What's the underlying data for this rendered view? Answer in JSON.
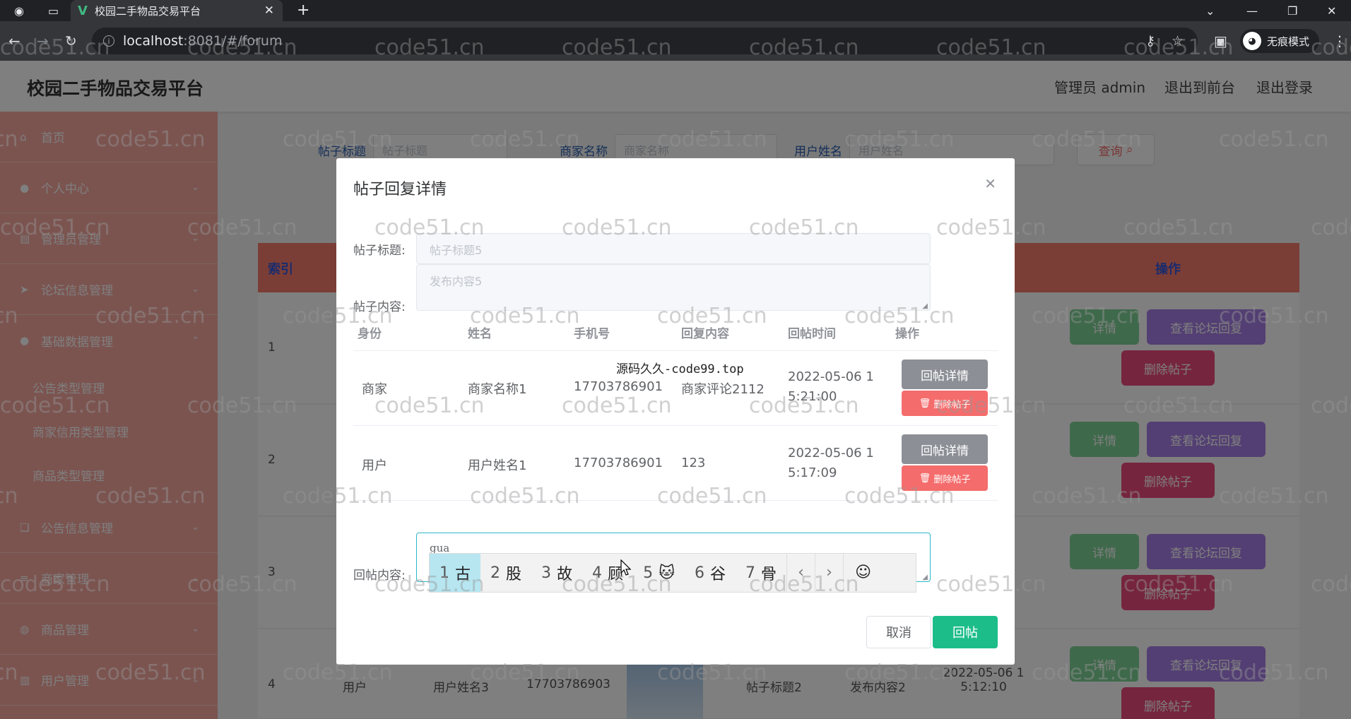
{
  "browser": {
    "tab_title": "校园二手物品交易平台",
    "url_host": "localhost",
    "url_rest": ":8081/#/forum",
    "incognito_label": "无痕模式"
  },
  "header": {
    "title": "校园二手物品交易平台",
    "links": [
      "管理员 admin",
      "退出到前台",
      "退出登录"
    ]
  },
  "sidebar": {
    "items": [
      {
        "label": "首页",
        "icon": "home-icon"
      },
      {
        "label": "个人中心",
        "icon": "user-icon"
      },
      {
        "label": "管理员管理",
        "icon": "admin-icon"
      },
      {
        "label": "论坛信息管理",
        "icon": "send-icon"
      },
      {
        "label": "基础数据管理",
        "icon": "user-icon"
      },
      {
        "label": "公告信息管理",
        "icon": "copy-icon"
      },
      {
        "label": "商家管理",
        "icon": "list-icon"
      },
      {
        "label": "商品管理",
        "icon": "globe-icon"
      },
      {
        "label": "用户管理",
        "icon": "doc-icon"
      }
    ],
    "subitems": [
      "公告类型管理",
      "商家信用类型管理",
      "商品类型管理"
    ]
  },
  "search": {
    "title_label": "帖子标题",
    "title_placeholder": "帖子标题",
    "merchant_label": "商家名称",
    "merchant_placeholder": "商家名称",
    "user_label": "用户姓名",
    "user_placeholder": "用户姓名",
    "query_button": "查询"
  },
  "table": {
    "headers": {
      "index": "索引",
      "actions": "操作"
    },
    "rows": [
      {
        "index": "1"
      },
      {
        "index": "2"
      },
      {
        "index": "3"
      },
      {
        "index": "4",
        "role": "用户",
        "name": "用户姓名3",
        "phone": "17703786903",
        "post_title": "帖子标题2",
        "content": "发布内容2",
        "time": "2022-05-06 1\n5:12:10"
      }
    ],
    "actions": {
      "detail": "详情",
      "view_replies": "查看论坛回复",
      "delete": "删除帖子"
    }
  },
  "dialog": {
    "title": "帖子回复详情",
    "post_title_label": "帖子标题:",
    "post_title_value": "帖子标题5",
    "post_content_label": "帖子内容:",
    "post_content_value": "发布内容5",
    "columns": [
      "身份",
      "姓名",
      "手机号",
      "回复内容",
      "回帖时间",
      "操作"
    ],
    "replies": [
      {
        "role": "商家",
        "name": "商家名称1",
        "phone": "17703786901",
        "content": "商家评论2112",
        "time_line1": "2022-05-06 1",
        "time_line2": "5:21:00"
      },
      {
        "role": "用户",
        "name": "用户姓名1",
        "phone": "17703786901",
        "content": "123",
        "time_line1": "2022-05-06 1",
        "time_line2": "5:17:09"
      }
    ],
    "reply_detail_button": "回帖详情",
    "delete_reply_button": "删除帖子",
    "reply_label": "回帖内容:",
    "reply_typed": "gua",
    "cancel_button": "取消",
    "submit_button": "回帖",
    "watermark_note": "源码久久-code99.top"
  },
  "ime": {
    "candidates": [
      {
        "n": "1",
        "c": "古"
      },
      {
        "n": "2",
        "c": "股"
      },
      {
        "n": "3",
        "c": "故"
      },
      {
        "n": "4",
        "c": "顾"
      },
      {
        "n": "5",
        "c": "🐱"
      },
      {
        "n": "6",
        "c": "谷"
      },
      {
        "n": "7",
        "c": "骨"
      }
    ],
    "prev": "‹",
    "next": "›",
    "emoji": "☺"
  },
  "watermark": "code51.cn"
}
